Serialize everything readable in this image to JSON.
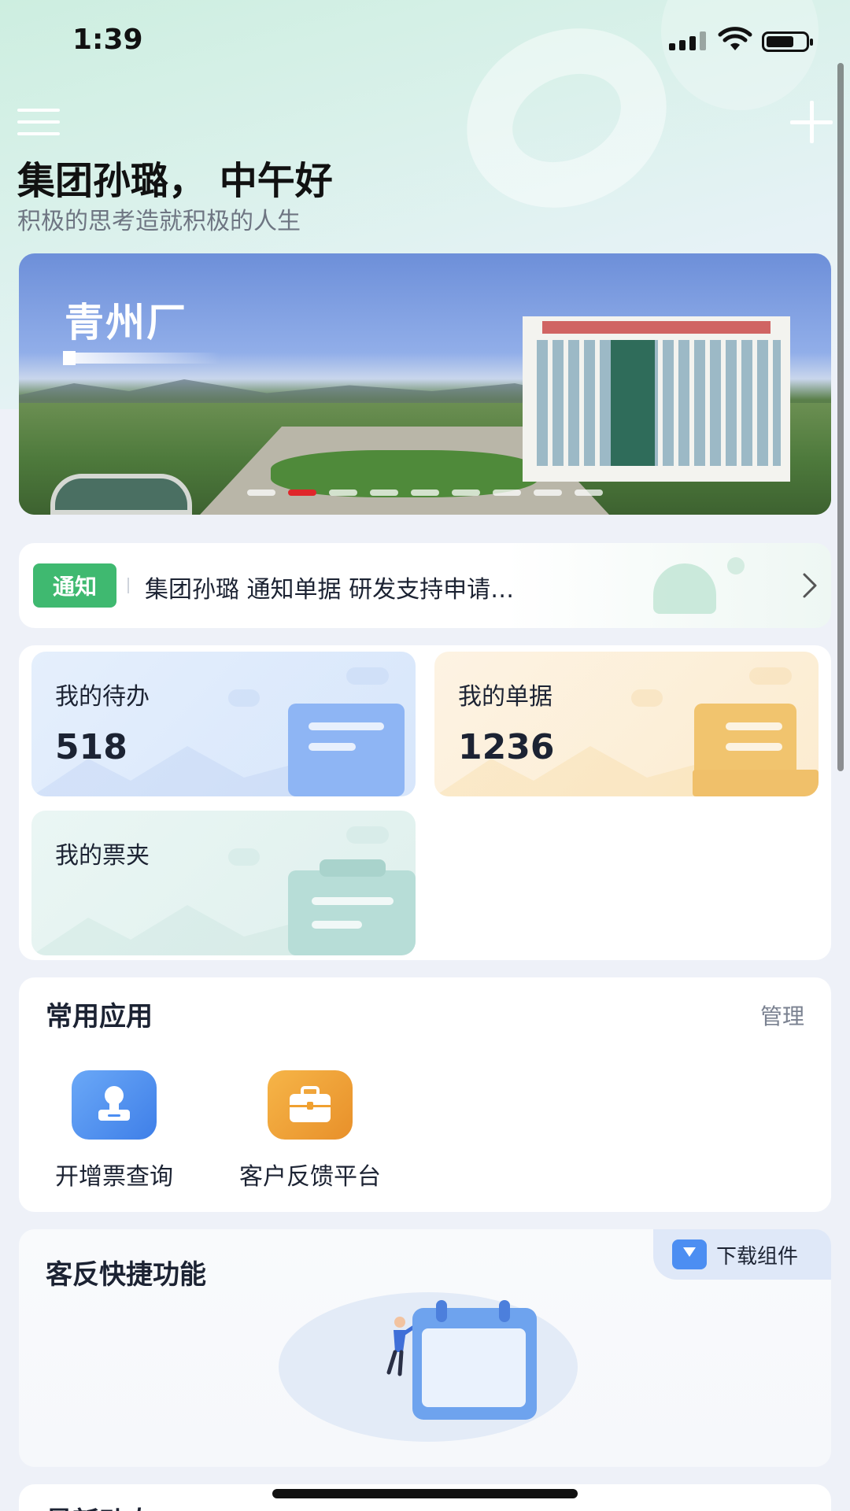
{
  "status_bar": {
    "time": "1:39"
  },
  "header": {
    "greeting": "集团孙璐， 中午好",
    "subtitle": "积极的思考造就积极的人生"
  },
  "banner": {
    "title": "青州厂",
    "slide_count": 9,
    "active_slide": 2
  },
  "notice": {
    "tag": "通知",
    "text": "集团孙璐 通知单据 研发支持申请…"
  },
  "stats": {
    "todo": {
      "label": "我的待办",
      "value": "518"
    },
    "bills": {
      "label": "我的单据",
      "value": "1236"
    },
    "folder": {
      "label": "我的票夹"
    }
  },
  "common_apps": {
    "title": "常用应用",
    "manage_label": "管理",
    "items": [
      {
        "label": "开增票查询",
        "icon": "stamp-icon",
        "color": "#4c8ef2"
      },
      {
        "label": "客户反馈平台",
        "icon": "briefcase-icon",
        "color": "#f0a030"
      }
    ]
  },
  "quick_functions": {
    "title": "客反快捷功能",
    "download_label": "下载组件"
  },
  "recent": {
    "title": "最新动态"
  },
  "colors": {
    "accent_green": "#3fb970",
    "accent_blue": "#4c8ef2",
    "accent_orange": "#f0a030",
    "banner_active_dot": "#e0262a"
  }
}
